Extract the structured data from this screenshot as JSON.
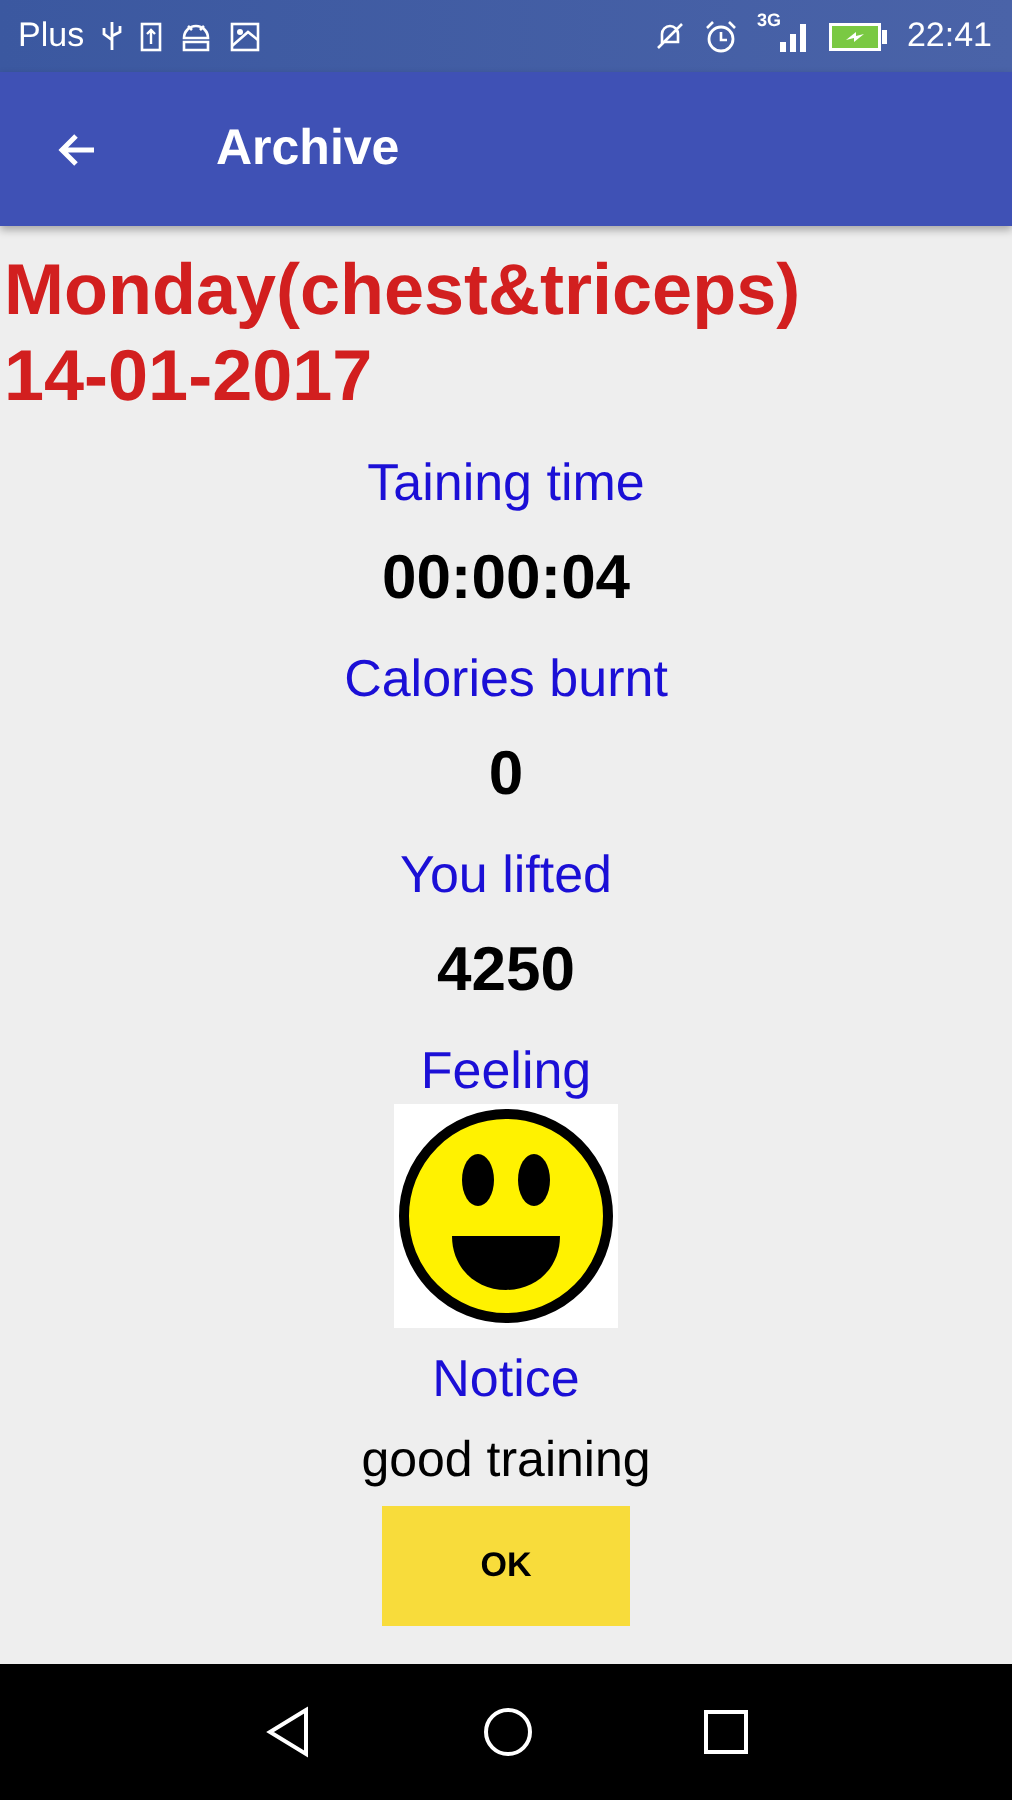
{
  "status_bar": {
    "carrier": "Plus",
    "time": "22:41",
    "network": "3G"
  },
  "app_bar": {
    "title": "Archive"
  },
  "workout": {
    "name": "Monday(chest&triceps)",
    "date": "14-01-2017"
  },
  "stats": [
    {
      "label": "Taining time",
      "value": "00:00:04"
    },
    {
      "label": "Calories burnt",
      "value": "0"
    },
    {
      "label": "You lifted",
      "value": "4250"
    }
  ],
  "feeling": {
    "label": "Feeling"
  },
  "notice": {
    "label": "Notice",
    "text": "good training"
  },
  "buttons": [
    "OK"
  ]
}
